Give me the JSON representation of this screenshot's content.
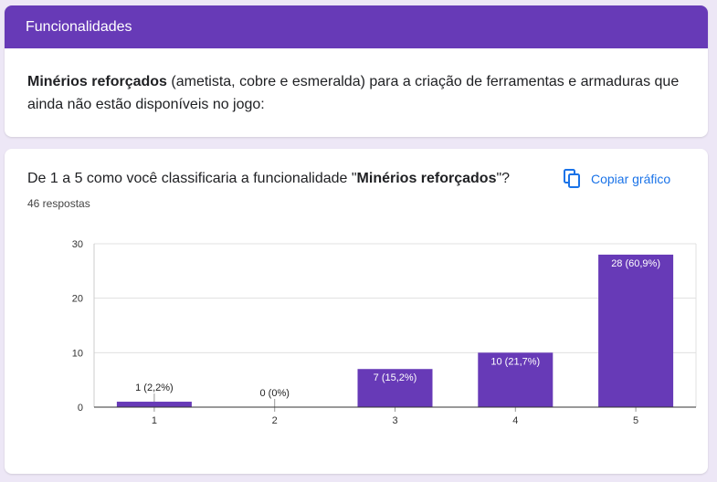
{
  "section": {
    "title": "Funcionalidades",
    "desc_bold": "Minérios reforçados",
    "desc_rest": " (ametista, cobre e esmeralda) para a criação de ferramentas e armaduras que ainda não estão disponíveis no jogo:"
  },
  "question": {
    "title_prefix": "De 1 a 5 como você classificaria a funcionalidade \"",
    "title_bold": "Minérios reforçados",
    "title_suffix": "\"?",
    "responses": "46 respostas",
    "copy_label": "Copiar gráfico",
    "copy_icon": "copy-icon"
  },
  "colors": {
    "accent": "#673ab7",
    "link": "#1a73e8"
  },
  "chart_data": {
    "type": "bar",
    "categories": [
      "1",
      "2",
      "3",
      "4",
      "5"
    ],
    "values": [
      1,
      0,
      7,
      10,
      28
    ],
    "data_labels": [
      "1 (2,2%)",
      "0 (0%)",
      "7 (15,2%)",
      "10 (21,7%)",
      "28 (60,9%)"
    ],
    "yticks": [
      "0",
      "10",
      "20",
      "30"
    ],
    "ylim": [
      0,
      30
    ],
    "grid": true,
    "color": "#673ab7"
  }
}
